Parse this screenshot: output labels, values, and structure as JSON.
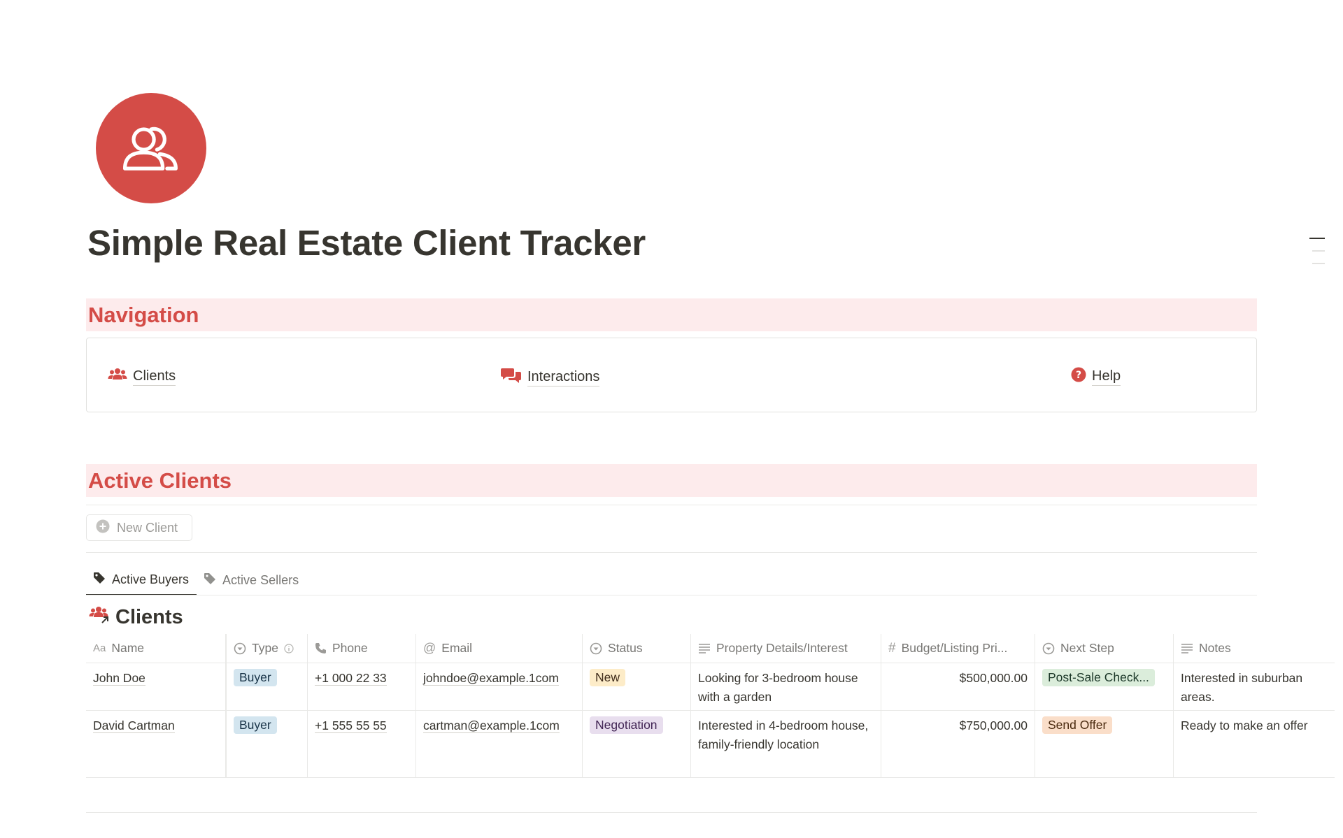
{
  "page": {
    "title": "Simple Real Estate Client Tracker",
    "icon": "users-icon",
    "accent_color": "#d44c47"
  },
  "navigation": {
    "heading": "Navigation",
    "links": [
      {
        "label": "Clients",
        "icon": "users-icon"
      },
      {
        "label": "Interactions",
        "icon": "chat-bubbles-icon"
      },
      {
        "label": "Help",
        "icon": "question-circle-icon"
      }
    ]
  },
  "active_clients": {
    "heading": "Active Clients",
    "new_button": "New Client",
    "tabs": [
      {
        "label": "Active Buyers",
        "active": true
      },
      {
        "label": "Active Sellers",
        "active": false
      }
    ],
    "database_title": "Clients",
    "columns": {
      "name": "Name",
      "type": "Type",
      "phone": "Phone",
      "email": "Email",
      "status": "Status",
      "property": "Property Details/Interest",
      "budget": "Budget/Listing Pri...",
      "next_step": "Next Step",
      "notes": "Notes"
    },
    "column_icons": {
      "name": "Aa",
      "type": "select-icon",
      "phone": "phone-icon",
      "email": "@",
      "status": "select-icon",
      "property": "text-lines-icon",
      "budget": "#",
      "next_step": "select-icon",
      "notes": "text-lines-icon"
    },
    "rows": [
      {
        "name": "John Doe",
        "type": "Buyer",
        "phone": "+1 000 22 33",
        "email": "johndoe@example.1com",
        "status": "New",
        "property": "Looking for 3-bedroom house with a garden",
        "budget": "$500,000.00",
        "next_step": "Post-Sale Check...",
        "notes": "Interested in suburban areas."
      },
      {
        "name": "David Cartman",
        "type": "Buyer",
        "phone": "+1 555 55 55",
        "email": "cartman@example.1com",
        "status": "Negotiation",
        "property": "Interested in 4-bedroom house, family-friendly location",
        "budget": "$750,000.00",
        "next_step": "Send Offer",
        "notes": "Ready to make an offer"
      }
    ]
  }
}
